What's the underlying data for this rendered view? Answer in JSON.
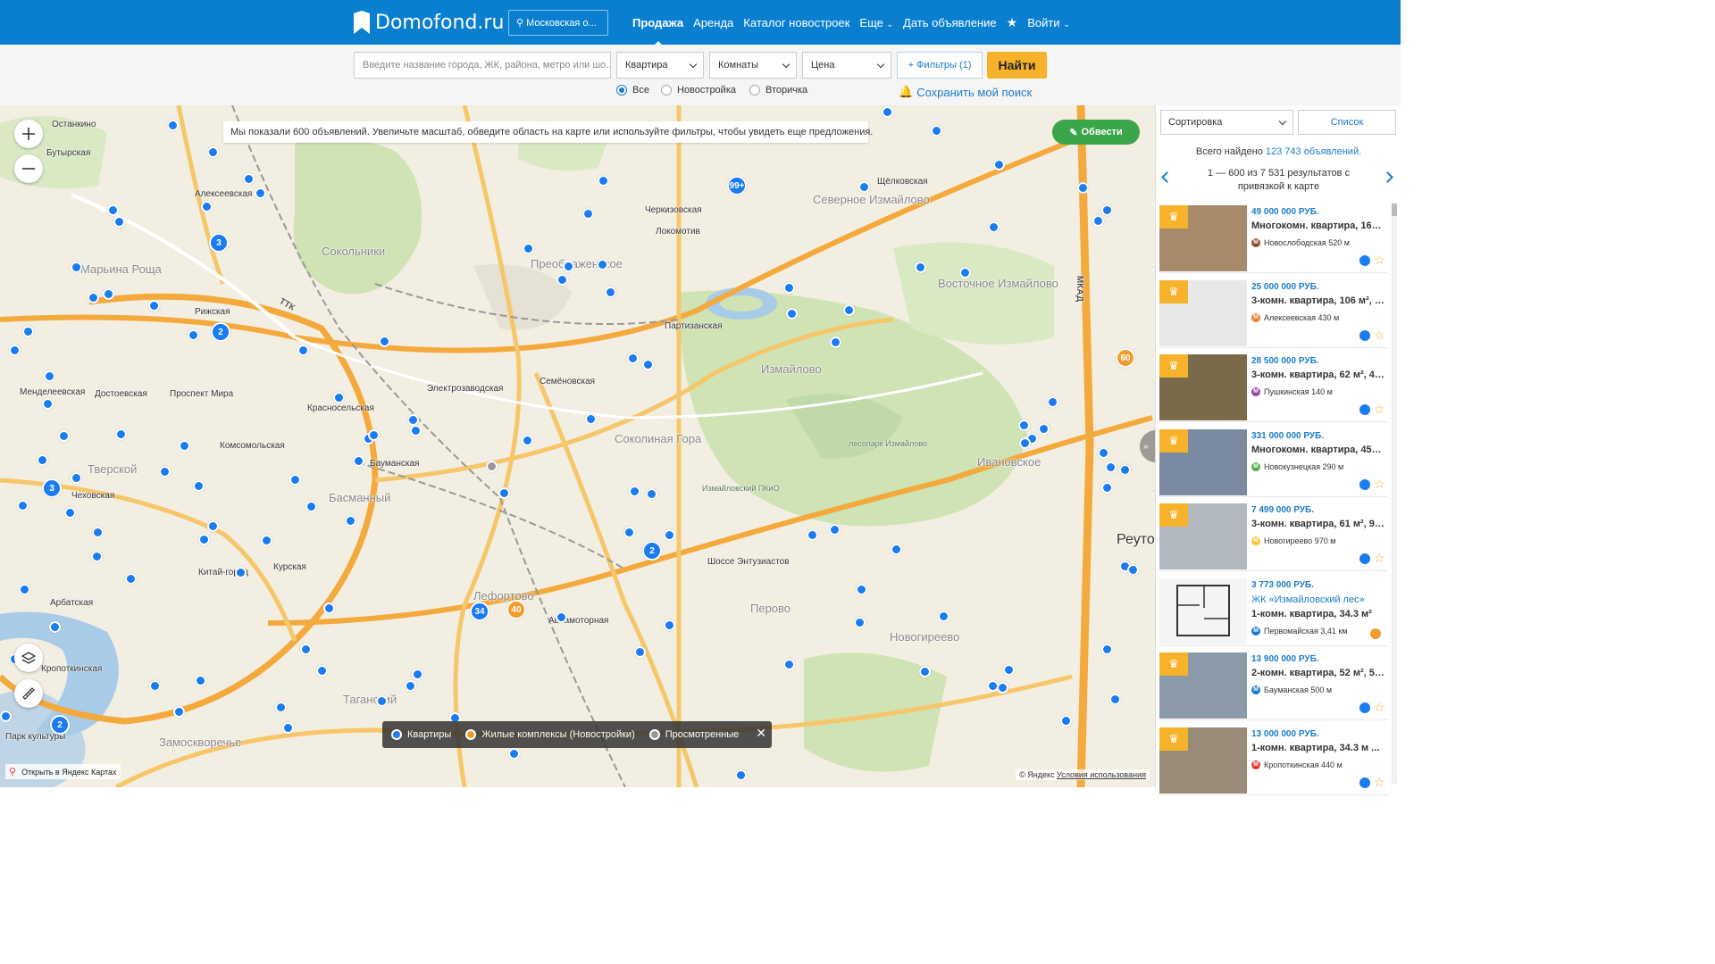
{
  "header": {
    "logo": "Domofond.ru",
    "region": "Московская о...",
    "nav": [
      "Продажа",
      "Аренда",
      "Каталог новостроек",
      "Еще",
      "Дать объявление",
      "Войти"
    ]
  },
  "search": {
    "placeholder": "Введите название города, ЖК, района, метро или шо...",
    "type": "Квартира",
    "rooms": "Комнаты",
    "price": "Цена",
    "filters": "+ Фильтры (1)",
    "find": "Найти",
    "radio": [
      "Все",
      "Новостройка",
      "Вторичка"
    ],
    "save": "Сохранить мой поиск"
  },
  "map": {
    "tip": "Мы показали 600 объявлений. Увеличьте масштаб, обведите область на карте или используйте фильтры, чтобы увидеть еще предложения.",
    "draw": "Обвести",
    "legend": [
      "Квартиры",
      "Жилые комплексы (Новостройки)",
      "Просмотренные"
    ],
    "open_yandex": "Открыть в Яндекс Картах",
    "copyright": "© Яндекс",
    "terms": "Условия использования",
    "clusters": [
      "99+",
      "3",
      "2",
      "3",
      "2",
      "2",
      "34",
      "40",
      "60"
    ],
    "labels": {
      "ostankino": "Останкино",
      "butyrskaya": "Бутырская",
      "alekseevskaya": "Алексеевская",
      "marina": "Марьина Роща",
      "rizhskaya": "Рижская",
      "sokolniki": "Сокольники",
      "preobr": "Преображенское",
      "cherk": "Черкизовская",
      "lokomotiv": "Локомотив",
      "shchelk": "Щёлковская",
      "sev_izm": "Северное Измайлово",
      "vost_izm": "Восточное Измайлово",
      "izmailovo": "Измайлово",
      "partizan": "Партизанская",
      "sokol_gora": "Соколиная Гора",
      "mendeleev": "Менделеевская",
      "dostoev": "Достоевская",
      "prospekt_mira": "Проспект Мира",
      "krasnosel": "Красносельская",
      "komsomol": "Комсомольская",
      "baumanskaya": "Бауманская",
      "basmanny": "Басманный",
      "tverskoy": "Тверской",
      "chekhov": "Чеховская",
      "kursk": "Курская",
      "kitai": "Китай-город",
      "lefortovo": "Лефортово",
      "aviamotor": "Авиамоторная",
      "perovo": "Перово",
      "novogireevo": "Новогиреево",
      "ivanovskoe": "Ивановское",
      "reutov": "Реутов",
      "taganka": "Таганский",
      "zamoskv": "Замоскворечье",
      "arbat": "Арбатская",
      "kropot": "Кропоткинская",
      "park_kult": "Парк культуры",
      "shosse_entuz": "Шоссе Энтузиастов",
      "semen": "Семёновская",
      "elektrozav": "Электрозаводская",
      "mkad": "МКАД",
      "ttk": "ТТК",
      "izm_pkio": "Измайловский ПКиО",
      "lesopark": "лесопарк Измайлово"
    }
  },
  "sidebar": {
    "sort": "Сортировка",
    "list": "Список",
    "total_prefix": "Всего найдено ",
    "total_link": "123 743 объявлений.",
    "range": "1 — 600 из 7 531 результатов с привязкой к карте",
    "cards": [
      {
        "price": "49 000 000 РУБ.",
        "title": "Многокомн. квартира, 160 ...",
        "metro": "Новослободская 520 м",
        "mcolor": "#8a4a2c",
        "mletter": "М"
      },
      {
        "price": "25 000 000 РУБ.",
        "title": "3-комн. квартира, 106 м², 1...",
        "metro": "Алексеевская 430 м",
        "mcolor": "#f07e26",
        "mletter": "М"
      },
      {
        "price": "28 500 000 РУБ.",
        "title": "3-комн. квартира, 62 м², 4/...",
        "metro": "Пушкинская 140 м",
        "mcolor": "#9b3fa6",
        "mletter": "М"
      },
      {
        "price": "331 000 000 РУБ.",
        "title": "Многокомн. квартира, 455....",
        "metro": "Новокузнецкая 290 м",
        "mcolor": "#4caf50",
        "mletter": "М"
      },
      {
        "price": "7 499 000 РУБ.",
        "title": "3-комн. квартира, 61 м², 9/...",
        "metro": "Новогиреево 970 м",
        "mcolor": "#f6c43a",
        "mletter": "М"
      },
      {
        "price": "3 773 000 РУБ.",
        "jk": "ЖК «Измайловский лес»",
        "title": "1-комн. квартира, 34.3 м²",
        "metro": "Первомайская 3,41 км",
        "mcolor": "#1a7cc9",
        "mletter": "М"
      },
      {
        "price": "13 900 000 РУБ.",
        "title": "2-комн. квартира, 52 м², 5/...",
        "metro": "Бауманская 500 м",
        "mcolor": "#1a7cc9",
        "mletter": "М"
      },
      {
        "price": "13 000 000 РУБ.",
        "title": "1-комн. квартира, 34.3 м ...",
        "metro": "Кропоткинская 440 м",
        "mcolor": "#e53935",
        "mletter": "М"
      }
    ]
  },
  "colors": {
    "brand": "#0a7fd0",
    "accent": "#f6b22a",
    "dot": "#1a7cf0",
    "new": "#f19c30",
    "viewed": "#999999"
  }
}
